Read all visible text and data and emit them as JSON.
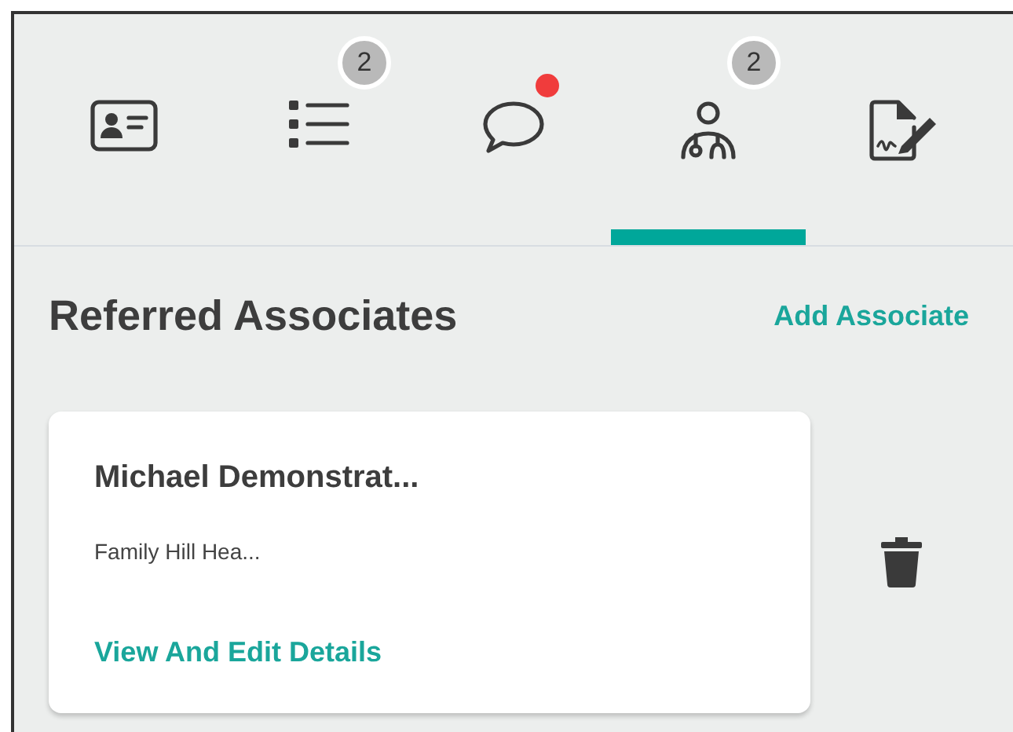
{
  "tabs": [
    {
      "dot": false,
      "selected": false
    },
    {
      "badge": "2",
      "dot": false,
      "selected": false
    },
    {
      "dot": true,
      "selected": false
    },
    {
      "badge": "2",
      "dot": false,
      "selected": true
    },
    {
      "dot": false,
      "selected": false
    }
  ],
  "section": {
    "title": "Referred Associates",
    "action": "Add Associate"
  },
  "associates": [
    {
      "name": "Michael Demonstrat...",
      "organization": "Family Hill Hea...",
      "link": "View And Edit Details"
    }
  ]
}
